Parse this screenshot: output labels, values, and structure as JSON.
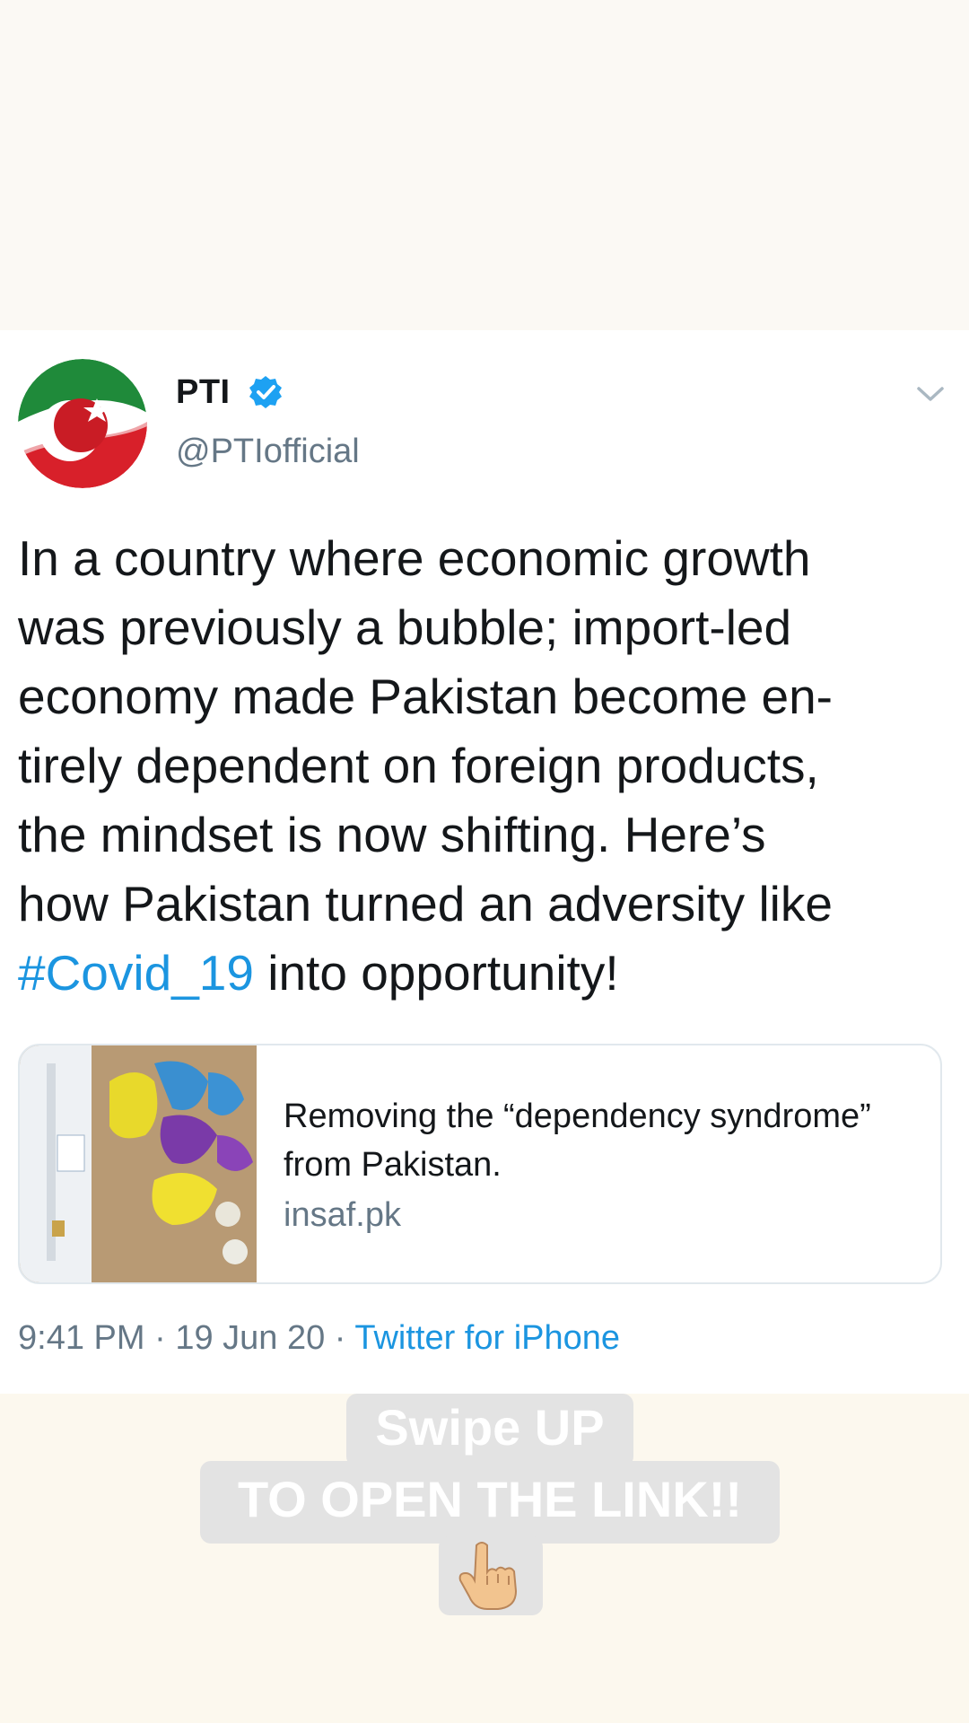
{
  "tweet": {
    "display_name": "PTI",
    "handle": "@PTIofficial",
    "text_lines": [
      "In a country where economic growth",
      "was previously a bubble; import-led",
      "economy made Pakistan become en-",
      "tirely dependent on foreign products,",
      "the mindset is now shifting. Here’s",
      "how Pakistan turned an adversity like"
    ],
    "hashtag": "#Covid_19",
    "text_tail": " into opportunity!",
    "link_card": {
      "title": "Removing the “dependency syndrome” from Pakistan.",
      "domain": "insaf.pk"
    },
    "time": "9:41 PM",
    "date": "19 Jun 20",
    "separator": " · ",
    "source": "Twitter for iPhone"
  },
  "overlay": {
    "line1": "Swipe UP",
    "line2": "TO OPEN THE LINK!!",
    "emoji_icon": "pointing-down-hand-icon"
  },
  "colors": {
    "link_blue": "#1b95e0",
    "secondary_gray": "#657786",
    "text_black": "#14171a",
    "verified_blue": "#1da1f2",
    "overlay_gray": "#e3e3e3"
  }
}
